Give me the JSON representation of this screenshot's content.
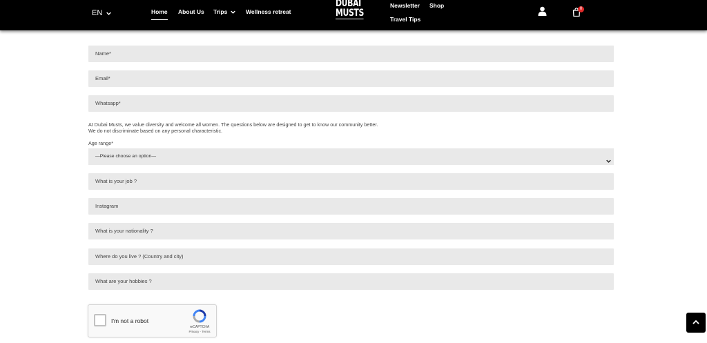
{
  "header": {
    "language": "EN",
    "nav": {
      "home": "Home",
      "about": "About Us",
      "trips": "Trips",
      "wellness": "Wellness retreat",
      "newsletter": "Newsletter",
      "shop": "Shop",
      "travel_tips": "Travel Tips"
    },
    "logo_line1": "DUBAI",
    "logo_line2": "MUSTS",
    "cart_count": "0"
  },
  "form": {
    "name_placeholder": "Name*",
    "email_placeholder": "Email*",
    "whatsapp_placeholder": "Whatsapp*",
    "disclaimer_line1": "At Dubai Musts, we value diversity and welcome all women. The questions below are designed to get to know our community better.",
    "disclaimer_line2": "We do not discriminate based on any personal characteristic.",
    "age_label": "Age range*",
    "age_selected": "—Please choose an option—",
    "job_placeholder": "What is your job ?",
    "instagram_placeholder": "Instagram",
    "nationality_placeholder": "What is your nationality ?",
    "live_placeholder": "Where do you live ? (Country and city)",
    "hobbies_placeholder": "What are your hobbies ?"
  },
  "captcha": {
    "label": "I'm not a robot",
    "brand": "reCAPTCHA",
    "links": "Privacy - Terms"
  },
  "colors": {
    "header_bg": "#000000",
    "field_bg": "#e9e9e9",
    "badge": "#e32b2b"
  }
}
